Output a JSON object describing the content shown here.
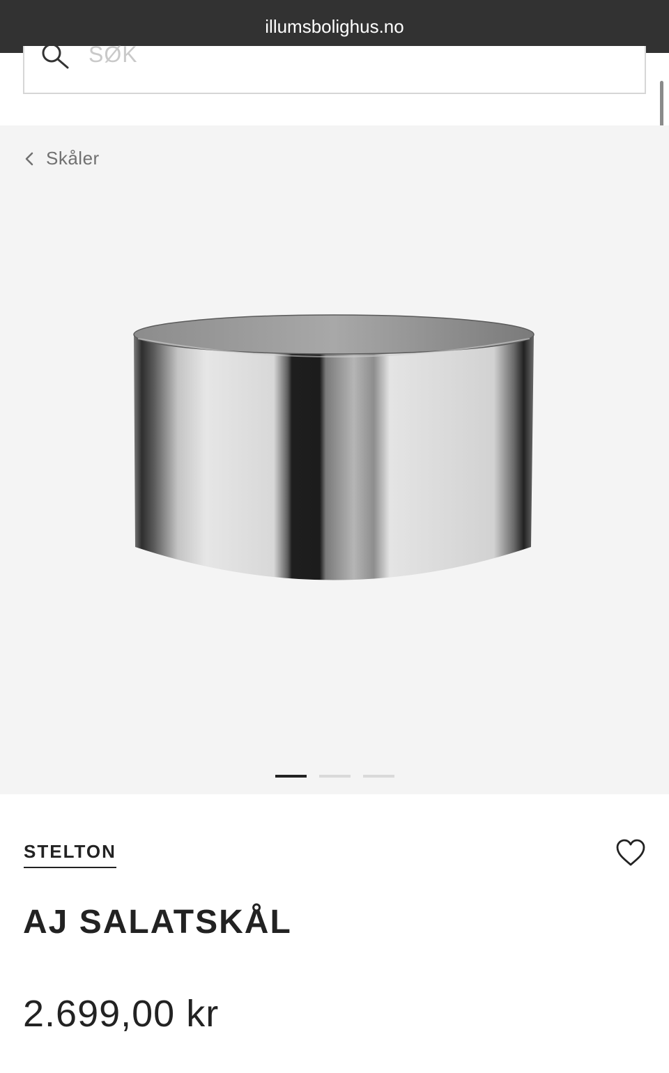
{
  "browser": {
    "url": "illumsbolighus.no"
  },
  "search": {
    "placeholder": "SØK"
  },
  "breadcrumb": {
    "label": "Skåler"
  },
  "gallery": {
    "slide_count": 3,
    "active_slide": 1
  },
  "product": {
    "brand": "STELTON",
    "title": "AJ SALATSKÅL",
    "price": "2.699,00 kr"
  },
  "icons": {
    "search": "search-icon",
    "back": "chevron-left-icon",
    "favorite": "heart-icon"
  }
}
